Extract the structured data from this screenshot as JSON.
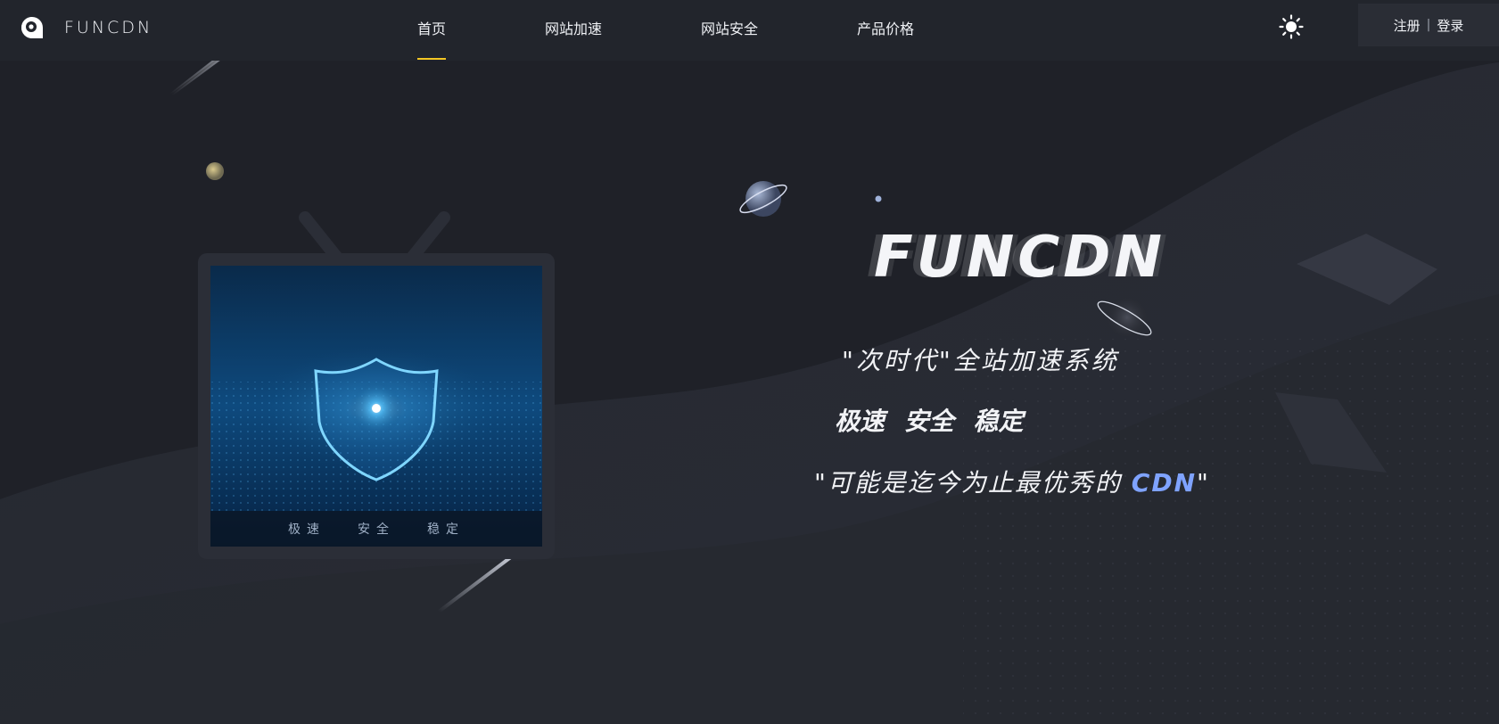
{
  "brand": {
    "logo_text": "FUNCDN"
  },
  "nav": {
    "items": [
      {
        "label": "首页",
        "active": true
      },
      {
        "label": "网站加速",
        "active": false
      },
      {
        "label": "网站安全",
        "active": false
      },
      {
        "label": "产品价格",
        "active": false
      }
    ],
    "theme_icon": "sun-icon"
  },
  "auth": {
    "register_label": "注册",
    "separator": "|",
    "login_label": "登录"
  },
  "hero": {
    "title": "FUNCDN",
    "slogan_1": "\"次时代\"全站加速系统",
    "slogan_2": "极速  安全  稳定",
    "slogan_3_prefix": "\"可能是迄今为止最优秀的 ",
    "slogan_3_accent": "CDN",
    "slogan_3_suffix": "\""
  },
  "tv": {
    "caption_items": [
      "极速",
      "安全",
      "稳定"
    ]
  },
  "colors": {
    "background": "#1f2128",
    "navbar": "#22252c",
    "active_underline": "#f3c623",
    "accent_blue": "#7fa3ff",
    "shield_glow": "#4fc3ff"
  }
}
